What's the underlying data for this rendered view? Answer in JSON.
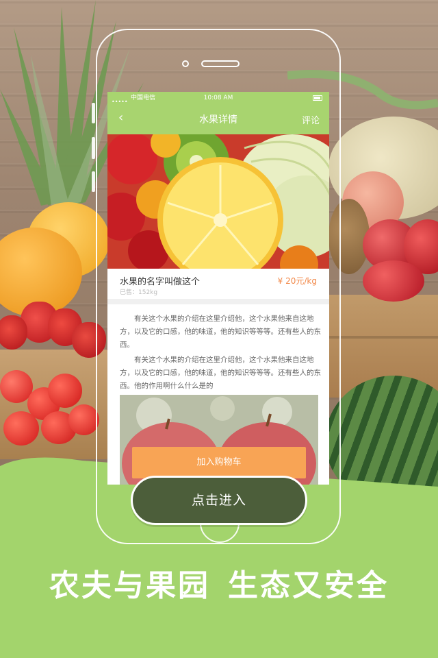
{
  "status_bar": {
    "carrier": "中国电信",
    "time": "10:08 AM"
  },
  "nav": {
    "title": "水果详情",
    "comment_label": "评论"
  },
  "product": {
    "name": "水果的名字叫做这个",
    "price": "¥ 20元/kg",
    "sold": "已售：152kg"
  },
  "description": {
    "paragraph_1": "有关这个水果的介绍在这里介绍他，这个水果他来自这地方，以及它的口感，他的味道，他的知识等等等。还有些人的东西。",
    "paragraph_2": "有关这个水果的介绍在这里介绍他，这个水果他来自这地方，以及它的口感，他的味道，他的知识等等等。还有些人的东西。他的作用啊什么什么是的"
  },
  "actions": {
    "add_to_cart": "加入购物车",
    "enter": "点击进入"
  },
  "slogan": {
    "left": "农夫与果园",
    "right": "生态又安全"
  },
  "colors": {
    "nav_green": "#a8d46f",
    "ground_green": "#a3d46c",
    "price_orange": "#f2894a",
    "cart_orange": "#f8a455",
    "enter_dark": "#4c5e3a"
  }
}
